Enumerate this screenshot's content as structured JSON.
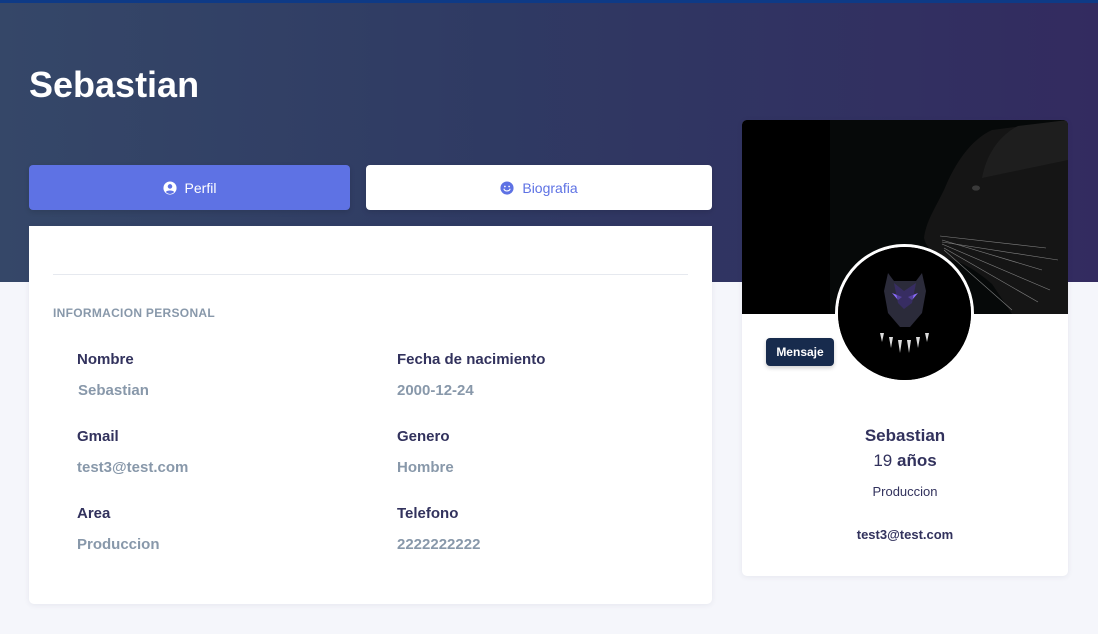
{
  "header": {
    "title": "Sebastian"
  },
  "tabs": [
    {
      "label": "Perfil",
      "icon": "user-circle-icon",
      "active": true
    },
    {
      "label": "Biografia",
      "icon": "smile-icon",
      "active": false
    }
  ],
  "personal_info": {
    "section_title": "INFORMACION PERSONAL",
    "fields": [
      {
        "label": "Nombre",
        "value": "Sebastian"
      },
      {
        "label": "Fecha de nacimiento",
        "value": "2000-12-24"
      },
      {
        "label": "Gmail",
        "value": "test3@test.com"
      },
      {
        "label": "Genero",
        "value": "Hombre"
      },
      {
        "label": "Area",
        "value": "Produccion"
      },
      {
        "label": "Telefono",
        "value": "2222222222"
      }
    ]
  },
  "profile_card": {
    "message_button": "Mensaje",
    "name": "Sebastian",
    "age_number": "19",
    "age_unit": "años",
    "area": "Produccion",
    "email": "test3@test.com"
  },
  "colors": {
    "accent": "#5e72e4",
    "dark_button": "#172b4d",
    "heading_text": "#32325d",
    "muted_text": "#8898aa"
  }
}
